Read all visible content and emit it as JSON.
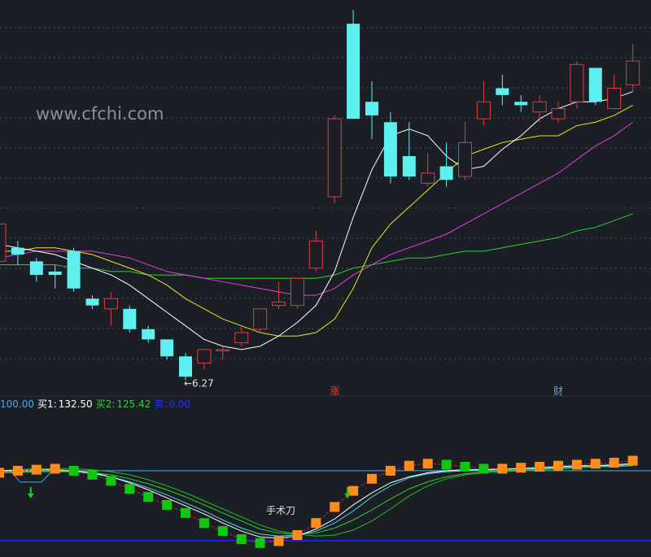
{
  "watermark": "www.cfchi.com",
  "colors": {
    "background": "#1c1e25",
    "up": "#e03c3c",
    "down": "#5ef0f0",
    "ma5": "#ffffff",
    "ma10": "#e8e820",
    "ma20": "#e040e0",
    "ma60": "#30d030",
    "grid": "#3a4a60",
    "ind_up": "#ff8c1a",
    "ind_down": "#10c810",
    "ind_line": "#4aa8e8",
    "base_line": "#2020e0"
  },
  "status": {
    "item0": "100.00",
    "buy1_label": "买1:",
    "buy1_value": "132.50",
    "buy2_label": "买2:",
    "buy2_value": "125.42",
    "sell_label": "卖:",
    "sell_value": "0.00"
  },
  "chart_data": [
    {
      "type": "candlestick",
      "price_range": [
        5.5,
        17.0
      ],
      "low_label": "6.27",
      "markers": [
        "涨",
        "财"
      ],
      "candles": [
        {
          "o": 9.3,
          "c": 10.4,
          "h": 10.6,
          "l": 9.2
        },
        {
          "o": 9.7,
          "c": 9.5,
          "h": 9.9,
          "l": 9.2
        },
        {
          "o": 9.3,
          "c": 8.9,
          "h": 9.4,
          "l": 8.7
        },
        {
          "o": 9.0,
          "c": 8.9,
          "h": 9.2,
          "l": 8.5
        },
        {
          "o": 9.6,
          "c": 8.5,
          "h": 9.7,
          "l": 8.4
        },
        {
          "o": 8.2,
          "c": 8.0,
          "h": 8.3,
          "l": 7.9
        },
        {
          "o": 7.9,
          "c": 8.2,
          "h": 8.4,
          "l": 7.4
        },
        {
          "o": 7.9,
          "c": 7.3,
          "h": 8.0,
          "l": 7.2
        },
        {
          "o": 7.3,
          "c": 7.0,
          "h": 7.4,
          "l": 6.9
        },
        {
          "o": 7.0,
          "c": 6.5,
          "h": 7.0,
          "l": 6.4
        },
        {
          "o": 6.5,
          "c": 5.9,
          "h": 6.6,
          "l": 5.8
        },
        {
          "o": 6.3,
          "c": 6.7,
          "h": 6.7,
          "l": 6.1
        },
        {
          "o": 6.7,
          "c": 6.7,
          "h": 6.8,
          "l": 6.4
        },
        {
          "o": 6.9,
          "c": 7.2,
          "h": 7.4,
          "l": 6.8
        },
        {
          "o": 7.3,
          "c": 7.9,
          "h": 7.9,
          "l": 7.2
        },
        {
          "o": 8.0,
          "c": 8.1,
          "h": 8.7,
          "l": 7.9
        },
        {
          "o": 8.0,
          "c": 8.8,
          "h": 8.8,
          "l": 7.9
        },
        {
          "o": 9.1,
          "c": 9.9,
          "h": 10.2,
          "l": 9.0
        },
        {
          "o": 11.2,
          "c": 13.5,
          "h": 13.6,
          "l": 11.0
        },
        {
          "o": 16.3,
          "c": 13.5,
          "h": 16.7,
          "l": 13.5
        },
        {
          "o": 14.0,
          "c": 13.6,
          "h": 14.6,
          "l": 12.9
        },
        {
          "o": 13.4,
          "c": 11.8,
          "h": 13.7,
          "l": 11.6
        },
        {
          "o": 12.4,
          "c": 11.8,
          "h": 13.4,
          "l": 11.7
        },
        {
          "o": 11.6,
          "c": 11.9,
          "h": 12.5,
          "l": 11.5
        },
        {
          "o": 12.1,
          "c": 11.7,
          "h": 12.8,
          "l": 11.5
        },
        {
          "o": 11.8,
          "c": 12.8,
          "h": 13.4,
          "l": 11.7
        },
        {
          "o": 13.5,
          "c": 14.0,
          "h": 14.6,
          "l": 13.3
        },
        {
          "o": 14.4,
          "c": 14.2,
          "h": 14.8,
          "l": 13.9
        },
        {
          "o": 14.0,
          "c": 13.9,
          "h": 14.2,
          "l": 13.7
        },
        {
          "o": 13.7,
          "c": 14.0,
          "h": 14.2,
          "l": 13.4
        },
        {
          "o": 13.5,
          "c": 13.8,
          "h": 14.0,
          "l": 13.4
        },
        {
          "o": 14.0,
          "c": 15.1,
          "h": 15.2,
          "l": 13.8
        },
        {
          "o": 15.0,
          "c": 14.0,
          "h": 15.0,
          "l": 13.9
        },
        {
          "o": 13.8,
          "c": 14.4,
          "h": 14.8,
          "l": 13.8
        },
        {
          "o": 14.5,
          "c": 15.2,
          "h": 15.7,
          "l": 14.3
        }
      ],
      "ma5": [
        9.8,
        9.7,
        9.6,
        9.5,
        9.3,
        9.1,
        8.9,
        8.6,
        8.2,
        7.8,
        7.4,
        7.0,
        6.8,
        6.7,
        6.8,
        7.1,
        7.5,
        8.0,
        9.0,
        10.6,
        12.0,
        13.0,
        13.2,
        13.0,
        12.4,
        12.0,
        12.1,
        12.6,
        13.0,
        13.5,
        13.8,
        14.0,
        14.0,
        14.1,
        14.3
      ],
      "ma10": [
        9.6,
        9.6,
        9.7,
        9.7,
        9.6,
        9.5,
        9.3,
        9.1,
        8.9,
        8.6,
        8.2,
        7.9,
        7.6,
        7.4,
        7.2,
        7.1,
        7.1,
        7.2,
        7.6,
        8.5,
        9.7,
        10.4,
        10.9,
        11.4,
        11.9,
        12.4,
        12.6,
        12.8,
        12.9,
        13.0,
        13.0,
        13.3,
        13.4,
        13.6,
        13.9
      ],
      "ma20": [
        9.4,
        9.5,
        9.6,
        9.6,
        9.6,
        9.6,
        9.5,
        9.4,
        9.2,
        9.0,
        8.9,
        8.8,
        8.7,
        8.6,
        8.5,
        8.4,
        8.3,
        8.3,
        8.5,
        8.9,
        9.2,
        9.5,
        9.7,
        9.9,
        10.1,
        10.4,
        10.7,
        11.0,
        11.3,
        11.6,
        11.9,
        12.3,
        12.7,
        13.0,
        13.4
      ],
      "ma60": [
        9.2,
        9.2,
        9.2,
        9.2,
        9.1,
        9.1,
        9.0,
        9.0,
        8.9,
        8.9,
        8.9,
        8.8,
        8.8,
        8.8,
        8.8,
        8.8,
        8.8,
        8.8,
        8.9,
        9.1,
        9.2,
        9.3,
        9.4,
        9.4,
        9.5,
        9.6,
        9.6,
        9.7,
        9.8,
        9.9,
        10.0,
        10.2,
        10.3,
        10.5,
        10.7
      ]
    },
    {
      "type": "indicator",
      "label": "手术刀",
      "y_range": [
        -5,
        105
      ],
      "signal": [
        78,
        80,
        81,
        82,
        80,
        76,
        70,
        62,
        54,
        46,
        38,
        28,
        20,
        12,
        8,
        10,
        16,
        28,
        44,
        60,
        72,
        80,
        85,
        87,
        86,
        84,
        82,
        82,
        83,
        84,
        85,
        86,
        87,
        88,
        90
      ],
      "line_white": [
        80,
        80,
        81,
        81,
        80,
        78,
        74,
        68,
        61,
        53,
        45,
        37,
        28,
        20,
        14,
        13,
        15,
        22,
        32,
        46,
        58,
        68,
        74,
        78,
        80,
        81,
        81,
        82,
        82,
        83,
        84,
        85,
        85,
        86,
        87
      ],
      "line_cyan": [
        79,
        79,
        80,
        80,
        79,
        77,
        74,
        69,
        63,
        56,
        48,
        40,
        31,
        23,
        17,
        15,
        16,
        20,
        28,
        40,
        54,
        65,
        73,
        77,
        79,
        80,
        81,
        81,
        82,
        82,
        83,
        84,
        85,
        85,
        86
      ],
      "line_green": [
        78,
        78,
        79,
        79,
        79,
        78,
        76,
        72,
        67,
        61,
        54,
        46,
        38,
        30,
        22,
        18,
        17,
        18,
        23,
        31,
        41,
        52,
        62,
        69,
        74,
        77,
        79,
        80,
        81,
        82,
        82,
        83,
        84,
        84,
        85
      ],
      "line_green2": [
        80,
        81,
        82,
        82,
        82,
        81,
        79,
        76,
        71,
        65,
        58,
        50,
        42,
        34,
        26,
        20,
        17,
        15,
        16,
        21,
        30,
        42,
        55,
        65,
        72,
        76,
        78,
        79,
        80,
        81,
        82,
        83,
        84,
        85,
        86
      ],
      "buy_arrows": [
        2,
        19
      ],
      "band_top": 80
    }
  ]
}
